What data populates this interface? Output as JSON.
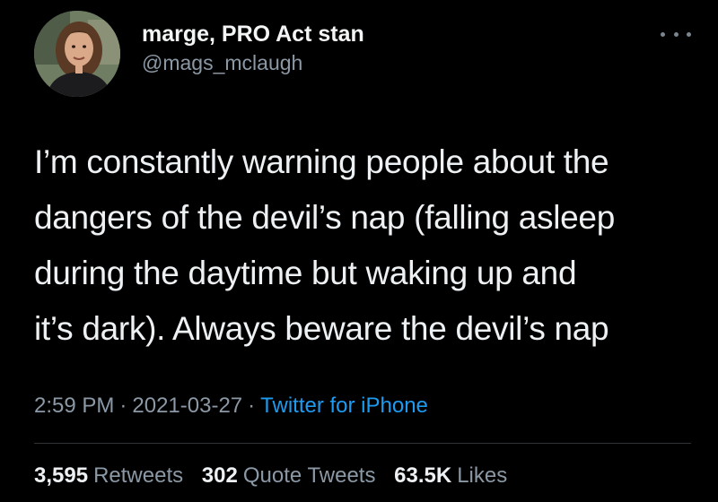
{
  "tweet": {
    "author": {
      "display_name": "marge, PRO Act stan",
      "handle": "@mags_mclaugh"
    },
    "more_icon": "more-horizontal-icon",
    "text_lines": [
      "I’m constantly warning people about the",
      "dangers of the devil’s nap (falling asleep",
      "during the daytime but waking up and",
      "it’s dark). Always beware the devil’s nap"
    ],
    "time": "2:59 PM",
    "date": "2021-03-27",
    "separator": "·",
    "source": "Twitter for iPhone",
    "stats": {
      "retweets_count": "3,595",
      "retweets_label": "Retweets",
      "quotes_count": "302",
      "quotes_label": "Quote Tweets",
      "likes_count": "63.5K",
      "likes_label": "Likes"
    }
  },
  "colors": {
    "background": "#000000",
    "text": "#eef1f3",
    "secondary_text": "#8b98a5",
    "link": "#1d9bf0",
    "divider": "#2f3336"
  }
}
